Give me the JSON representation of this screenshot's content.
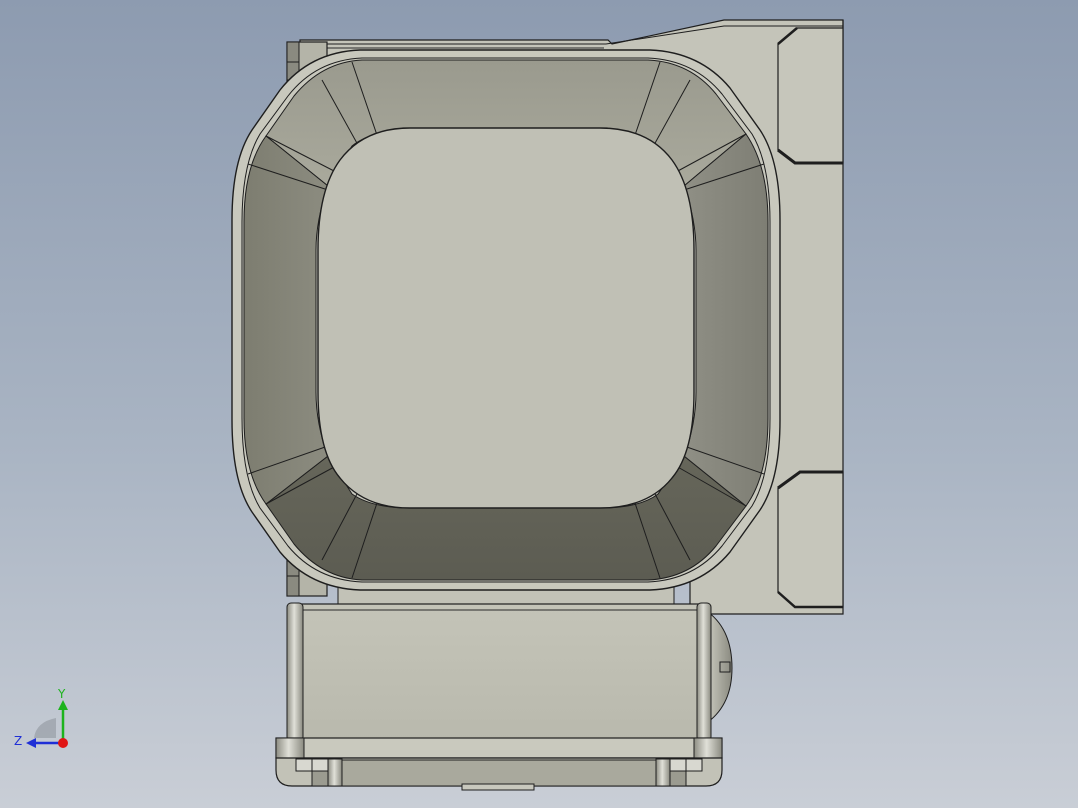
{
  "triad": {
    "x_label": "",
    "y_label": "Y",
    "z_label": "Z",
    "y_color": "#1db31d",
    "z_color": "#1f2fd6",
    "x_color": "#e01515"
  },
  "model": {
    "name_icon": "cad-part-icon",
    "shell_color": "#c2c2b7",
    "cavity_floor_color": "#c0c0b5",
    "cavity_wall_dark": "#6f6f62",
    "cavity_wall_light": "#b4b4a8",
    "outline_color": "#1e1e1e"
  }
}
